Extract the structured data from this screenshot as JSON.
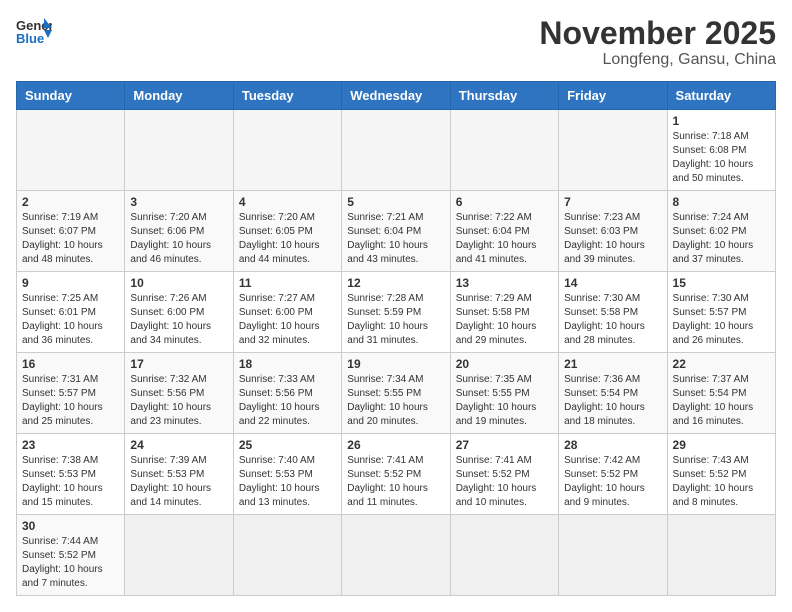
{
  "header": {
    "logo_general": "General",
    "logo_blue": "Blue",
    "month_title": "November 2025",
    "subtitle": "Longfeng, Gansu, China"
  },
  "weekdays": [
    "Sunday",
    "Monday",
    "Tuesday",
    "Wednesday",
    "Thursday",
    "Friday",
    "Saturday"
  ],
  "weeks": [
    [
      {
        "day": "",
        "info": ""
      },
      {
        "day": "",
        "info": ""
      },
      {
        "day": "",
        "info": ""
      },
      {
        "day": "",
        "info": ""
      },
      {
        "day": "",
        "info": ""
      },
      {
        "day": "",
        "info": ""
      },
      {
        "day": "1",
        "info": "Sunrise: 7:18 AM\nSunset: 6:08 PM\nDaylight: 10 hours and 50 minutes."
      }
    ],
    [
      {
        "day": "2",
        "info": "Sunrise: 7:19 AM\nSunset: 6:07 PM\nDaylight: 10 hours and 48 minutes."
      },
      {
        "day": "3",
        "info": "Sunrise: 7:20 AM\nSunset: 6:06 PM\nDaylight: 10 hours and 46 minutes."
      },
      {
        "day": "4",
        "info": "Sunrise: 7:20 AM\nSunset: 6:05 PM\nDaylight: 10 hours and 44 minutes."
      },
      {
        "day": "5",
        "info": "Sunrise: 7:21 AM\nSunset: 6:04 PM\nDaylight: 10 hours and 43 minutes."
      },
      {
        "day": "6",
        "info": "Sunrise: 7:22 AM\nSunset: 6:04 PM\nDaylight: 10 hours and 41 minutes."
      },
      {
        "day": "7",
        "info": "Sunrise: 7:23 AM\nSunset: 6:03 PM\nDaylight: 10 hours and 39 minutes."
      },
      {
        "day": "8",
        "info": "Sunrise: 7:24 AM\nSunset: 6:02 PM\nDaylight: 10 hours and 37 minutes."
      }
    ],
    [
      {
        "day": "9",
        "info": "Sunrise: 7:25 AM\nSunset: 6:01 PM\nDaylight: 10 hours and 36 minutes."
      },
      {
        "day": "10",
        "info": "Sunrise: 7:26 AM\nSunset: 6:00 PM\nDaylight: 10 hours and 34 minutes."
      },
      {
        "day": "11",
        "info": "Sunrise: 7:27 AM\nSunset: 6:00 PM\nDaylight: 10 hours and 32 minutes."
      },
      {
        "day": "12",
        "info": "Sunrise: 7:28 AM\nSunset: 5:59 PM\nDaylight: 10 hours and 31 minutes."
      },
      {
        "day": "13",
        "info": "Sunrise: 7:29 AM\nSunset: 5:58 PM\nDaylight: 10 hours and 29 minutes."
      },
      {
        "day": "14",
        "info": "Sunrise: 7:30 AM\nSunset: 5:58 PM\nDaylight: 10 hours and 28 minutes."
      },
      {
        "day": "15",
        "info": "Sunrise: 7:30 AM\nSunset: 5:57 PM\nDaylight: 10 hours and 26 minutes."
      }
    ],
    [
      {
        "day": "16",
        "info": "Sunrise: 7:31 AM\nSunset: 5:57 PM\nDaylight: 10 hours and 25 minutes."
      },
      {
        "day": "17",
        "info": "Sunrise: 7:32 AM\nSunset: 5:56 PM\nDaylight: 10 hours and 23 minutes."
      },
      {
        "day": "18",
        "info": "Sunrise: 7:33 AM\nSunset: 5:56 PM\nDaylight: 10 hours and 22 minutes."
      },
      {
        "day": "19",
        "info": "Sunrise: 7:34 AM\nSunset: 5:55 PM\nDaylight: 10 hours and 20 minutes."
      },
      {
        "day": "20",
        "info": "Sunrise: 7:35 AM\nSunset: 5:55 PM\nDaylight: 10 hours and 19 minutes."
      },
      {
        "day": "21",
        "info": "Sunrise: 7:36 AM\nSunset: 5:54 PM\nDaylight: 10 hours and 18 minutes."
      },
      {
        "day": "22",
        "info": "Sunrise: 7:37 AM\nSunset: 5:54 PM\nDaylight: 10 hours and 16 minutes."
      }
    ],
    [
      {
        "day": "23",
        "info": "Sunrise: 7:38 AM\nSunset: 5:53 PM\nDaylight: 10 hours and 15 minutes."
      },
      {
        "day": "24",
        "info": "Sunrise: 7:39 AM\nSunset: 5:53 PM\nDaylight: 10 hours and 14 minutes."
      },
      {
        "day": "25",
        "info": "Sunrise: 7:40 AM\nSunset: 5:53 PM\nDaylight: 10 hours and 13 minutes."
      },
      {
        "day": "26",
        "info": "Sunrise: 7:41 AM\nSunset: 5:52 PM\nDaylight: 10 hours and 11 minutes."
      },
      {
        "day": "27",
        "info": "Sunrise: 7:41 AM\nSunset: 5:52 PM\nDaylight: 10 hours and 10 minutes."
      },
      {
        "day": "28",
        "info": "Sunrise: 7:42 AM\nSunset: 5:52 PM\nDaylight: 10 hours and 9 minutes."
      },
      {
        "day": "29",
        "info": "Sunrise: 7:43 AM\nSunset: 5:52 PM\nDaylight: 10 hours and 8 minutes."
      }
    ],
    [
      {
        "day": "30",
        "info": "Sunrise: 7:44 AM\nSunset: 5:52 PM\nDaylight: 10 hours and 7 minutes."
      },
      {
        "day": "",
        "info": ""
      },
      {
        "day": "",
        "info": ""
      },
      {
        "day": "",
        "info": ""
      },
      {
        "day": "",
        "info": ""
      },
      {
        "day": "",
        "info": ""
      },
      {
        "day": "",
        "info": ""
      }
    ]
  ]
}
